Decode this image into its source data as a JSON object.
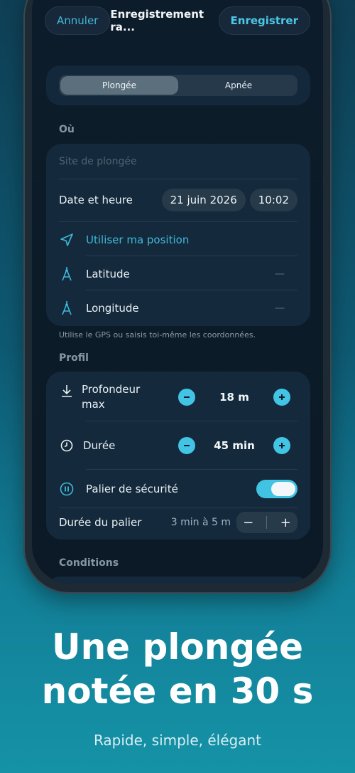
{
  "nav": {
    "cancel": "Annuler",
    "title": "Enregistrement ra...",
    "save": "Enregistrer"
  },
  "mode": {
    "options": [
      "Plongée",
      "Apnée"
    ],
    "selected": "Plongée"
  },
  "where": {
    "section": "Où",
    "site_placeholder": "Site de plongée",
    "date_label": "Date et heure",
    "date": "21 juin 2026",
    "time": "10:02",
    "use_position": "Utiliser ma position",
    "latitude": "Latitude",
    "latitude_value": "—",
    "longitude": "Longitude",
    "longitude_value": "—",
    "hint": "Utilise le GPS ou saisis toi-même les coordonnées."
  },
  "profile": {
    "section": "Profil",
    "depth_label_1": "Profondeur",
    "depth_label_2": "max",
    "depth_value": "18 m",
    "duration_label": "Durée",
    "duration_value": "45 min",
    "safety_stop_label": "Palier de sécurité",
    "safety_stop_on": true,
    "stop_duration_label": "Durée du palier",
    "stop_duration_value": "3 min à 5 m",
    "minus": "−",
    "plus": "+"
  },
  "conditions": {
    "section": "Conditions"
  },
  "promo": {
    "headline_1": "Une plongée",
    "headline_2": "notée en 30 s",
    "subline": "Rapide, simple, élégant"
  },
  "colors": {
    "accent": "#41c3e5",
    "background": "#0d1c2a",
    "card": "#142a3c"
  }
}
